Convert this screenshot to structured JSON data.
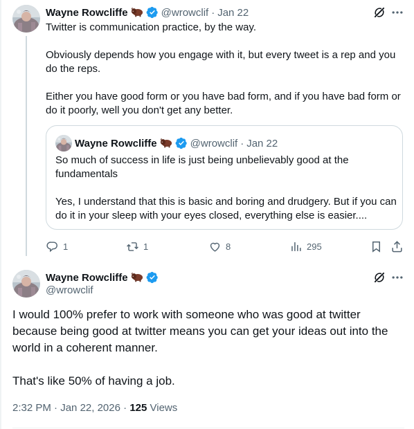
{
  "tweet1": {
    "author_name": "Wayne Rowcliffe",
    "handle": "@wrowclif",
    "separator": "·",
    "date": "Jan 22",
    "body": [
      "Twitter is communication practice, by the way.",
      "Obviously depends how you engage with it, but every tweet is a rep and you do the reps.",
      "Either you have good form or you have bad form, and if you have bad form or do it poorly, well you don't get any better."
    ],
    "quote": {
      "author_name": "Wayne Rowcliffe",
      "handle": "@wrowclif",
      "separator": "·",
      "date": "Jan 22",
      "body": [
        "So much of success in life is just being unbelievably good at the fundamentals",
        "Yes, I understand that this is basic and boring and drudgery. But if you can do it in your sleep with your eyes closed, everything else is easier...."
      ]
    },
    "actions": {
      "replies": "1",
      "reposts": "1",
      "likes": "8",
      "views": "295"
    }
  },
  "tweet2": {
    "author_name": "Wayne Rowcliffe",
    "handle": "@wrowclif",
    "body": [
      "I would 100% prefer to work with someone who was good at twitter because being good at twitter means you can get your ideas out into the world in a coherent manner.",
      "That's like 50% of having a job."
    ],
    "time": "2:32 PM",
    "separator": "·",
    "date": "Jan 22, 2026",
    "separator2": "·",
    "views_count": "125",
    "views_label": "Views"
  },
  "icons": {
    "verified_badge": "verified-icon",
    "author_emoji": "bison-emoji-icon",
    "grok": "grok-icon",
    "more": "more-icon",
    "reply": "reply-icon",
    "repost": "repost-icon",
    "like": "heart-icon",
    "views": "analytics-icon",
    "bookmark": "bookmark-icon",
    "share": "share-icon"
  },
  "colors": {
    "text": "#0f1419",
    "muted": "#536471",
    "verified": "#1d9bf0",
    "border": "#cfd9de"
  }
}
